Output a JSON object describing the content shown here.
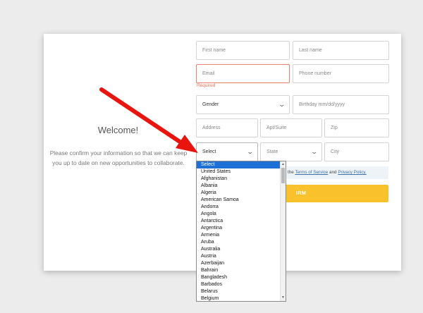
{
  "welcome": {
    "title": "Welcome!",
    "message": "Please confirm your information so that we can keep you up to date on new opportunities to collaborate."
  },
  "form": {
    "first_name": {
      "placeholder": "First name"
    },
    "last_name": {
      "placeholder": "Last name"
    },
    "email": {
      "placeholder": "Email",
      "error": "Required"
    },
    "phone": {
      "placeholder": "Phone number"
    },
    "gender": {
      "value": "Gender"
    },
    "birthday": {
      "placeholder": "Birthday mm/dd/yyyy"
    },
    "address": {
      "placeholder": "Address"
    },
    "apt": {
      "placeholder": "Apt/Suite"
    },
    "zip": {
      "placeholder": "Zip"
    },
    "country": {
      "value": "Select"
    },
    "state": {
      "value": "State"
    },
    "city": {
      "placeholder": "City"
    },
    "terms": {
      "prefix": "the",
      "tos": "Terms of Service",
      "and": "and",
      "privacy": "Privacy Policy."
    },
    "confirm_label": "IRM"
  },
  "country_dropdown": {
    "selected": "Select",
    "options": [
      "Select",
      "United States",
      "Afghanistan",
      "Albania",
      "Algeria",
      "American Samoa",
      "Andorra",
      "Angola",
      "Antarctica",
      "Argentina",
      "Armenia",
      "Aruba",
      "Australia",
      "Austria",
      "Azerbaijan",
      "Bahrain",
      "Bangladesh",
      "Barbados",
      "Belarus",
      "Belgium"
    ]
  },
  "colors": {
    "accent_button": "#f9c12c",
    "error": "#e4705c",
    "selection": "#1e70d6",
    "arrow": "#e8140e"
  },
  "icons": {
    "select_caret": "chevron-down-icon",
    "annotation": "red-arrow"
  }
}
